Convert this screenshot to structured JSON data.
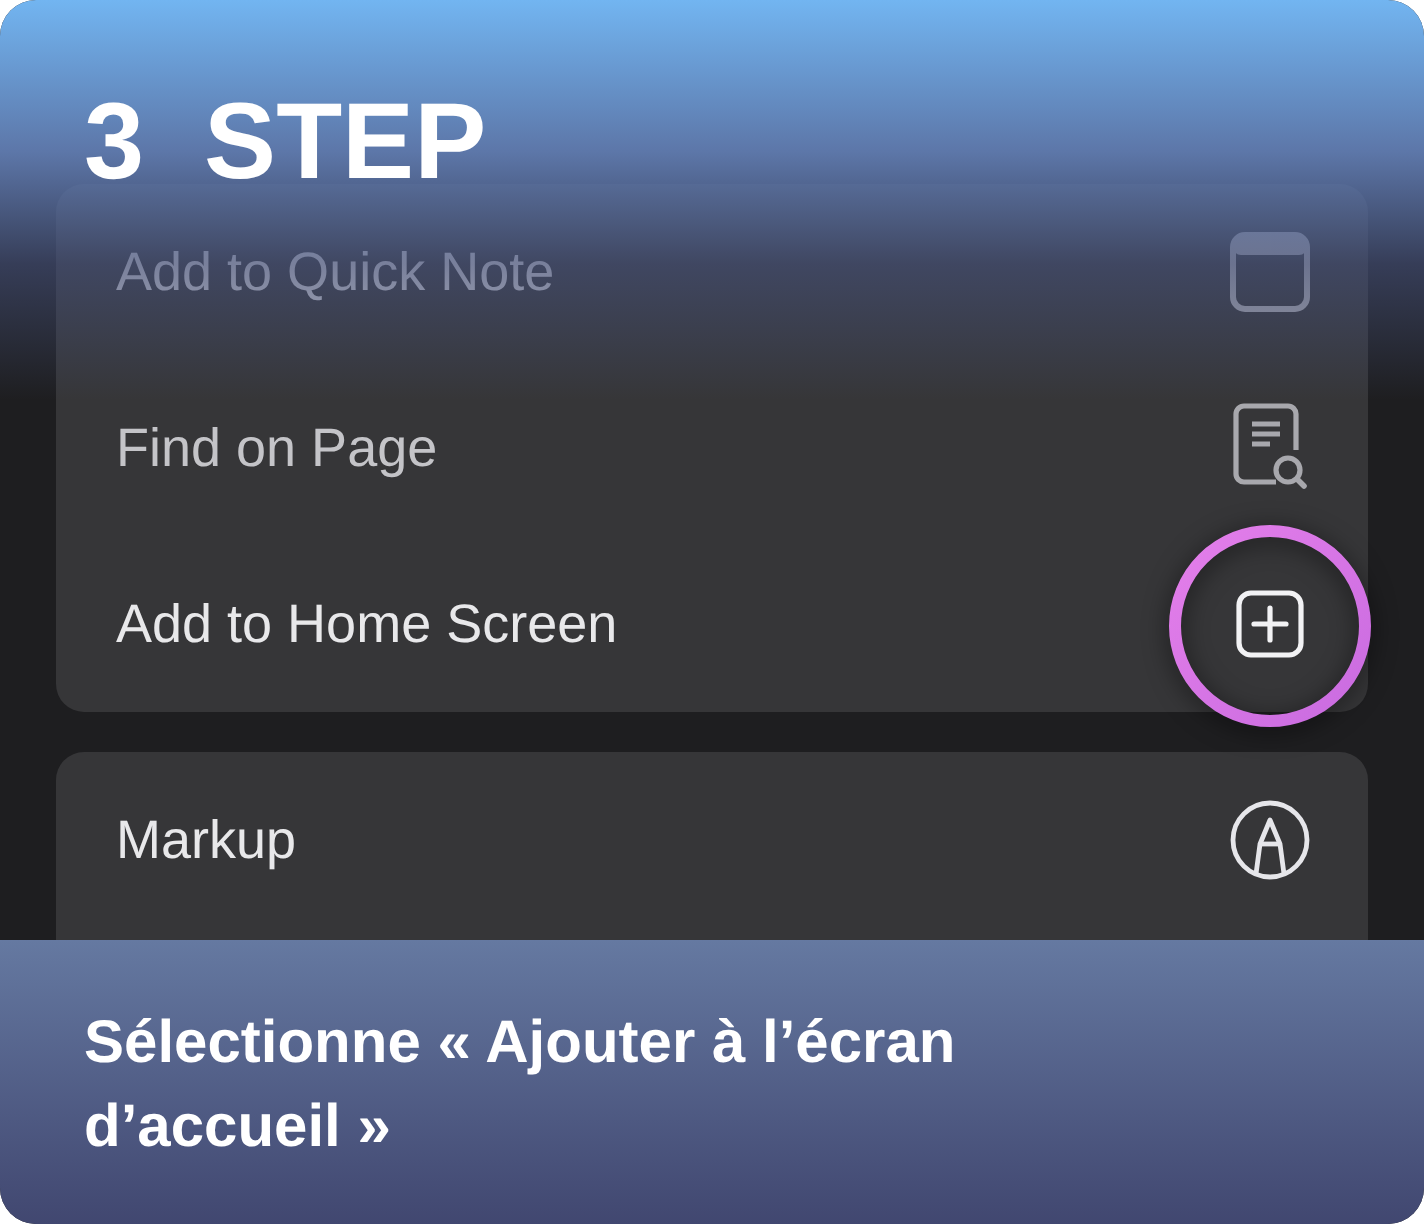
{
  "step": {
    "number": "3",
    "label": "STEP"
  },
  "menu_groups": [
    {
      "items": [
        {
          "label": "Add to Quick Note",
          "dimmed": true,
          "highlighted": false
        },
        {
          "label": "Find on Page",
          "dimmed": true,
          "highlighted": false
        },
        {
          "label": "Add to Home Screen",
          "dimmed": false,
          "highlighted": true
        }
      ]
    },
    {
      "items": [
        {
          "label": "Markup",
          "dimmed": false,
          "highlighted": false
        }
      ]
    }
  ],
  "caption": "Sélectionne « Ajouter à l’écran d’accueil »"
}
